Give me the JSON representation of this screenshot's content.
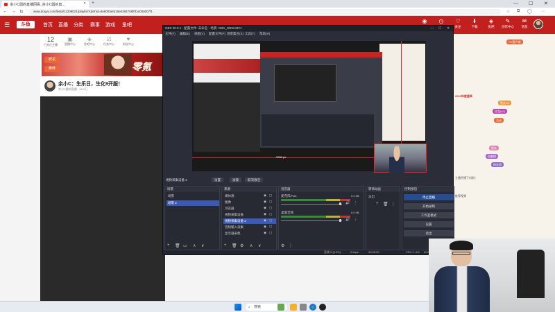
{
  "browser": {
    "tab_title": "余小C圆的直播回看_余小C圆的直...",
    "tab_close": "✕",
    "new_tab": "+",
    "url": "www.douyu.com/beta/11209021/playlist?dyshid=8e80f0a6b18e6284758f0f1e000007f1",
    "nav": {
      "back": "←",
      "forward": "→",
      "reload": "↻"
    },
    "win": {
      "min": "—",
      "max": "☐",
      "close": "✕"
    }
  },
  "site": {
    "logo": "斗鱼",
    "nav_items": [
      "首页",
      "直播",
      "分类",
      "赛事",
      "游戏",
      "鱼吧"
    ],
    "icons": [
      {
        "name": "live-icon",
        "glyph": "◉",
        "label": "直播"
      },
      {
        "name": "history-icon",
        "glyph": "◷",
        "label": "历史"
      },
      {
        "name": "follow-icon",
        "glyph": "♡",
        "label": "关注"
      },
      {
        "name": "download-icon",
        "glyph": "⬇",
        "label": "下载"
      },
      {
        "name": "fish-icon",
        "glyph": "◈",
        "label": "鱼吧"
      },
      {
        "name": "creator-icon",
        "glyph": "✎",
        "label": "创作中心"
      },
      {
        "name": "message-icon",
        "glyph": "✉",
        "label": "消息"
      }
    ],
    "stats": [
      {
        "value": "12",
        "label": "已关注主播"
      },
      {
        "value": "",
        "label": "直播中心"
      },
      {
        "value": "",
        "label": "鱼吧中心"
      },
      {
        "value": "",
        "label": "任务中心"
      },
      {
        "value": "",
        "label": "粉丝中心"
      }
    ],
    "banner_text": "零氪",
    "chips": [
      "鲜花",
      "推荐"
    ],
    "streamer": {
      "title": "余小C：生乐日，生化9开服！",
      "sub": "余小C圆的直播 · 28.0万"
    },
    "right_items": [
      "PC客户端",
      "2023年度盛典",
      "鱼丸×5",
      "红包(47)",
      "活动",
      "鱼丸",
      "贡献榜",
      "粉丝团",
      "主播开播了吗啦！",
      "推荐视频"
    ]
  },
  "obs": {
    "title": "OBS 30.0.1 - 配置文件: 未命名 - 场景: OBS_OBSHMO+",
    "menu": [
      "文件(F)",
      "编辑(E)",
      "视图(V)",
      "配置文件(P)",
      "场景集合(S)",
      "工具(T)",
      "帮助(H)"
    ],
    "preview_dim": "2000 px",
    "source_bar": {
      "label": "视频采集设备 2",
      "buttons": [
        "设置",
        "滤镜",
        "取消激活"
      ]
    },
    "scenes": {
      "title": "场景",
      "items": [
        "场景",
        "场景 2"
      ],
      "selected": 1
    },
    "sources": {
      "title": "来源",
      "items": [
        "媒体源",
        "图像",
        "浏览器",
        "视频采集设备",
        "视频采集设备 2",
        "音频输入采集",
        "显示器采集"
      ],
      "selected": 4
    },
    "mixer": {
      "title": "混音器",
      "channels": [
        {
          "name": "麦克风/Aux",
          "db": "0.0 dB"
        },
        {
          "name": "桌面音频",
          "db": "0.0 dB"
        }
      ]
    },
    "transitions": {
      "title": "转场动画",
      "type": "淡出",
      "duration": "300 ms"
    },
    "controls": {
      "title": "控制按钮",
      "buttons": [
        "停止直播",
        "开始录制",
        "工作室模式",
        "设置",
        "退出"
      ]
    },
    "status": [
      "丢帧 0 (0.0%)",
      "0 kbps",
      "00:00:00",
      "CPU: 1.4%",
      "60.00 / 60.00 FPS"
    ]
  },
  "taskbar": {
    "search": "搜索"
  }
}
